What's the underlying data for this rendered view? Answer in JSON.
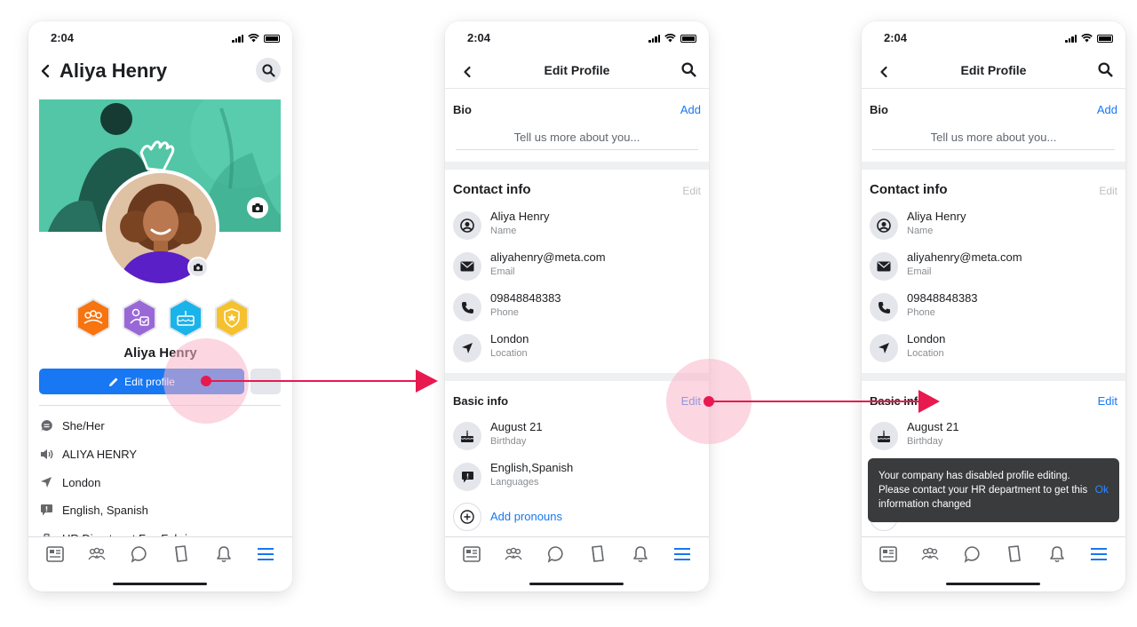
{
  "status_time": "2:04",
  "profile": {
    "name": "Aliya Henry",
    "edit_profile_label": "Edit profile",
    "intro": [
      {
        "icon": "pronouns-icon",
        "text": "She/Her"
      },
      {
        "icon": "name-pronunciation-icon",
        "text": "ALIYA HENRY"
      },
      {
        "icon": "location-icon",
        "text": "London"
      },
      {
        "icon": "languages-icon",
        "text": "English, Spanish"
      },
      {
        "icon": "work-icon",
        "text": "HR Director at Fox Fabrics"
      }
    ],
    "badge_colors": [
      "#f7740f",
      "#9a68d6",
      "#1ab3ea",
      "#f5c12e"
    ]
  },
  "edit_profile": {
    "title": "Edit Profile",
    "bio": {
      "heading": "Bio",
      "action": "Add",
      "placeholder": "Tell us more about you..."
    },
    "contact": {
      "heading": "Contact info",
      "action": "Edit",
      "items": [
        {
          "icon": "person-icon",
          "value": "Aliya Henry",
          "label": "Name"
        },
        {
          "icon": "email-icon",
          "value": "aliyahenry@meta.com",
          "label": "Email"
        },
        {
          "icon": "phone-icon",
          "value": "09848848383",
          "label": "Phone"
        },
        {
          "icon": "location-icon",
          "value": "London",
          "label": "Location"
        }
      ]
    },
    "basic": {
      "heading": "Basic info",
      "action": "Edit",
      "items": [
        {
          "icon": "birthday-cake-icon",
          "value": "August 21",
          "label": "Birthday"
        },
        {
          "icon": "languages-icon",
          "value": "English,Spanish",
          "label": "Languages"
        }
      ],
      "add_pronouns": "Add pronouns"
    }
  },
  "toast": {
    "message": "Your company has disabled profile editing. Please contact your HR department to get this information changed",
    "action": "Ok"
  },
  "tabbar": [
    "news-feed-icon",
    "groups-icon",
    "chat-icon",
    "knowledge-library-icon",
    "notifications-icon",
    "menu-icon"
  ],
  "colors": {
    "accent": "#1877f2",
    "annotation": "#e8194f",
    "tap_highlight": "#f9b5c8",
    "cover": "#4fc3a5"
  }
}
